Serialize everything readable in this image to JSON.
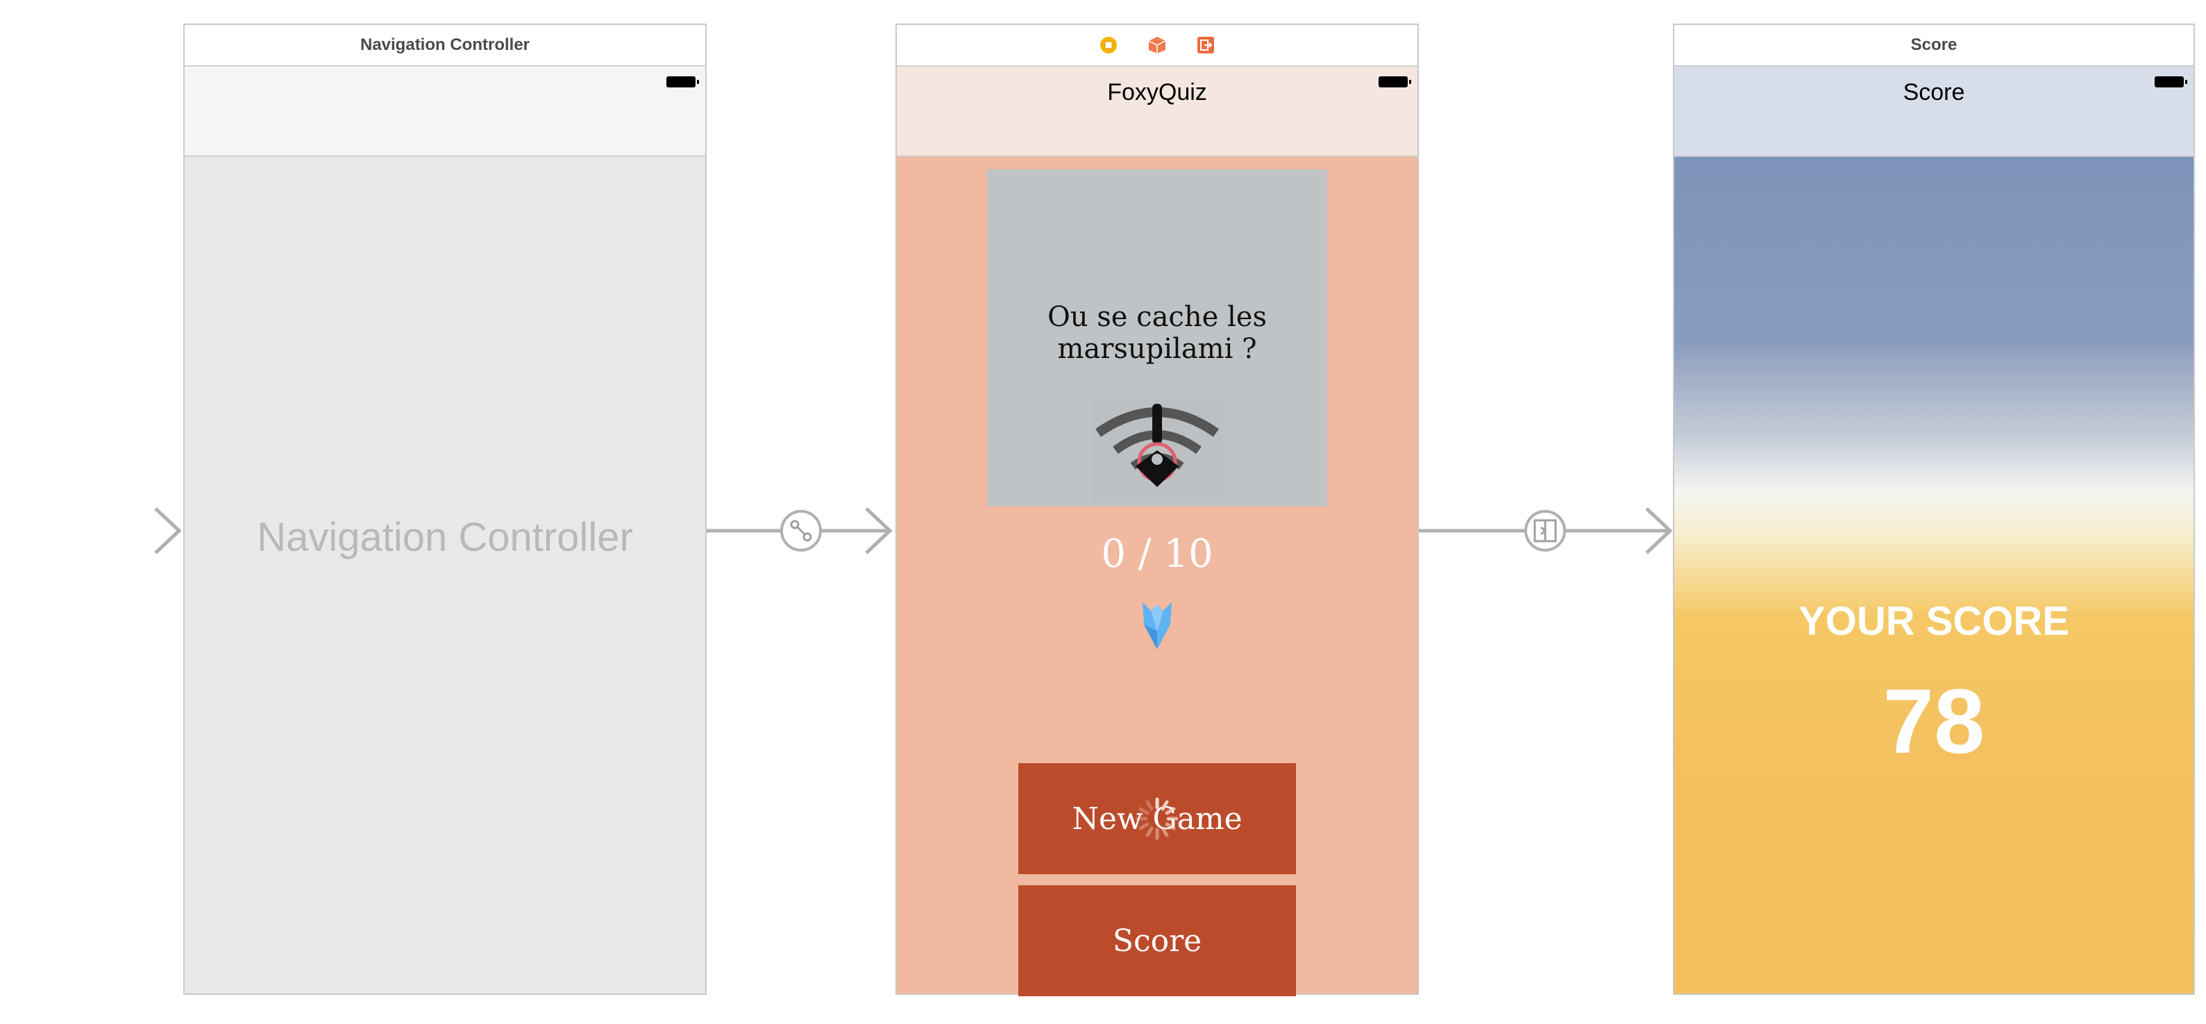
{
  "scenes": {
    "navigation": {
      "header_title": "Navigation Controller",
      "placeholder_label": "Navigation Controller"
    },
    "quiz": {
      "header_icons": [
        "view-controller-icon",
        "first-responder-icon",
        "exit-icon"
      ],
      "nav_title": "FoxyQuiz",
      "question": "Ou se cache les marsupilami ?",
      "progress": "0 / 10",
      "new_game_label": "New Game",
      "score_label": "Score"
    },
    "score": {
      "header_title": "Score",
      "nav_title": "Score",
      "your_score_label": "YOUR SCORE",
      "score_value": "78"
    }
  },
  "segues": [
    "entry-point-arrow",
    "root-view-controller-segue",
    "show-segue"
  ],
  "colors": {
    "quiz_background": "#f0b9a0",
    "quiz_button": "#bc4b2b",
    "quiz_navbar": "#f5e7df",
    "score_navbar": "#d8dee9",
    "score_gradient_top": "#7e93b9",
    "score_gradient_bottom": "#f3c05f"
  }
}
